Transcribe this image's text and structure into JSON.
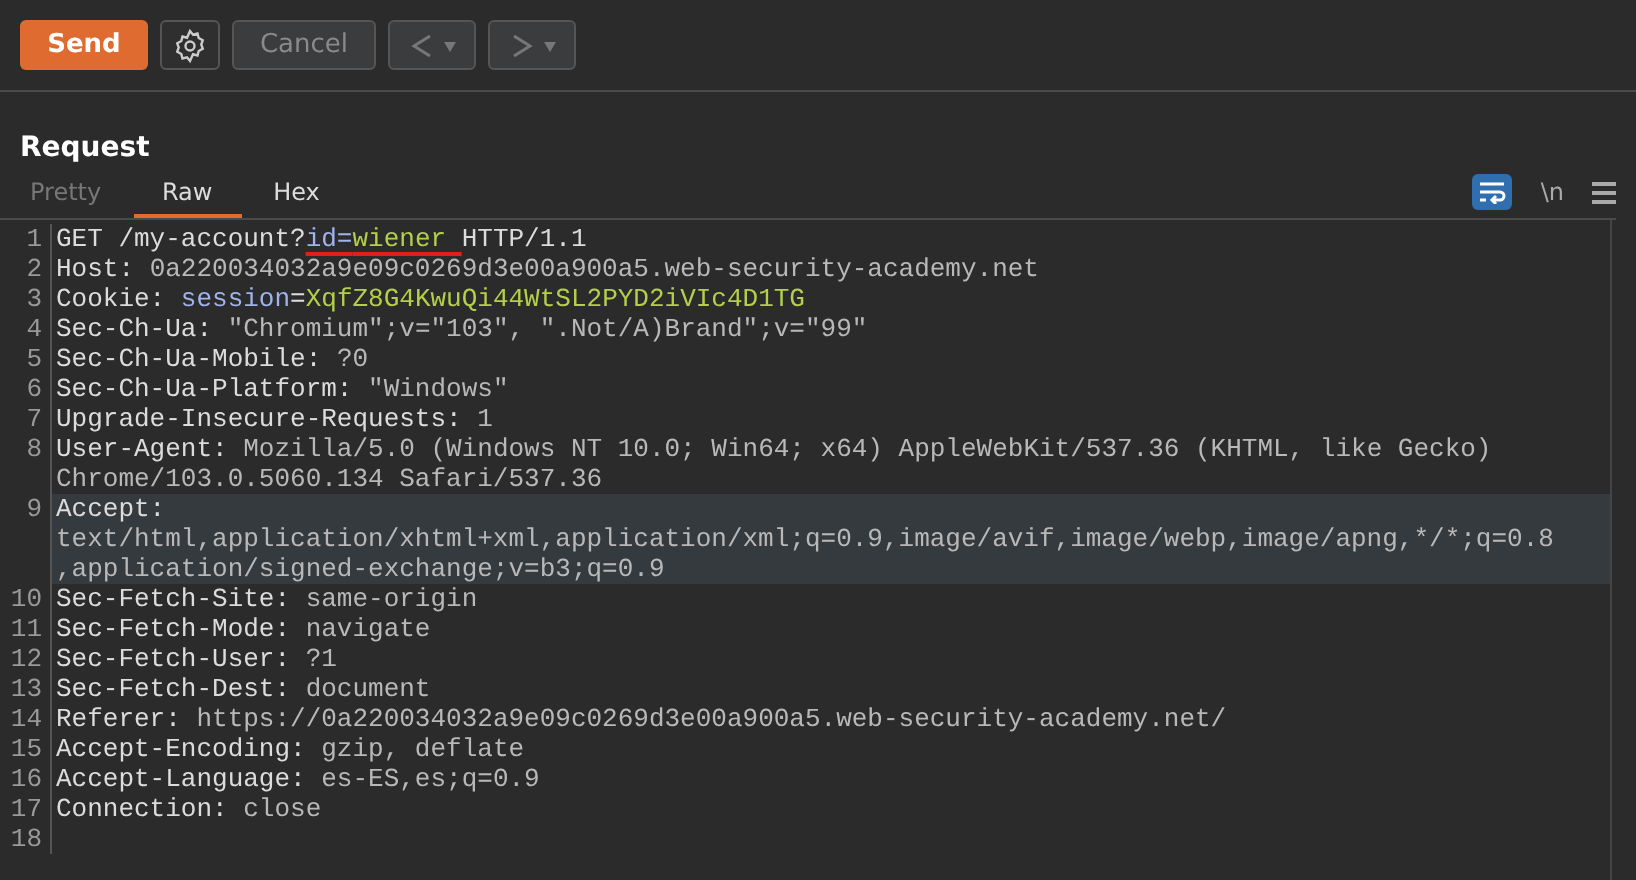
{
  "toolbar": {
    "send": "Send",
    "cancel": "Cancel",
    "back_disabled": true,
    "forward_disabled": true
  },
  "panel": {
    "title": "Request",
    "tabs": [
      {
        "label": "Pretty",
        "selected": false,
        "disabled": true
      },
      {
        "label": "Raw",
        "selected": true,
        "disabled": false
      },
      {
        "label": "Hex",
        "selected": false,
        "disabled": false
      }
    ],
    "wrap_on": true,
    "newline_label": "\\n"
  },
  "lines": [
    {
      "number": "1",
      "selected": false,
      "rows": [
        [
          {
            "text": "GET /my-account?",
            "kind": "name",
            "underlined": false
          },
          {
            "text": "id=",
            "kind": "param",
            "underlined": true
          },
          {
            "text": "wiener ",
            "kind": "param-value",
            "underlined": true
          },
          {
            "text": "HTTP/1.1",
            "kind": "name",
            "underlined": false
          }
        ]
      ]
    },
    {
      "number": "2",
      "selected": false,
      "rows": [
        [
          {
            "text": "Host: ",
            "kind": "name",
            "underlined": false
          },
          {
            "text": "0a220034032a9e09c0269d3e00a900a5.web-security-academy.net",
            "kind": "value",
            "underlined": false
          }
        ]
      ]
    },
    {
      "number": "3",
      "selected": false,
      "rows": [
        [
          {
            "text": "Cookie: ",
            "kind": "name",
            "underlined": false
          },
          {
            "text": "session",
            "kind": "param",
            "underlined": false
          },
          {
            "text": "=",
            "kind": "name",
            "underlined": false
          },
          {
            "text": "XqfZ8G4KwuQi44WtSL2PYD2iVIc4D1TG",
            "kind": "param-value",
            "underlined": false
          }
        ]
      ]
    },
    {
      "number": "4",
      "selected": false,
      "rows": [
        [
          {
            "text": "Sec-Ch-Ua: ",
            "kind": "name",
            "underlined": false
          },
          {
            "text": "\"Chromium\";v=\"103\", \".Not/A)Brand\";v=\"99\"",
            "kind": "value",
            "underlined": false
          }
        ]
      ]
    },
    {
      "number": "5",
      "selected": false,
      "rows": [
        [
          {
            "text": "Sec-Ch-Ua-Mobile: ",
            "kind": "name",
            "underlined": false
          },
          {
            "text": "?0",
            "kind": "value",
            "underlined": false
          }
        ]
      ]
    },
    {
      "number": "6",
      "selected": false,
      "rows": [
        [
          {
            "text": "Sec-Ch-Ua-Platform: ",
            "kind": "name",
            "underlined": false
          },
          {
            "text": "\"Windows\"",
            "kind": "value",
            "underlined": false
          }
        ]
      ]
    },
    {
      "number": "7",
      "selected": false,
      "rows": [
        [
          {
            "text": "Upgrade-Insecure-Requests: ",
            "kind": "name",
            "underlined": false
          },
          {
            "text": "1",
            "kind": "value",
            "underlined": false
          }
        ]
      ]
    },
    {
      "number": "8",
      "selected": false,
      "rows": [
        [
          {
            "text": "User-Agent: ",
            "kind": "name",
            "underlined": false
          },
          {
            "text": "Mozilla/5.0 (Windows NT 10.0; Win64; x64) AppleWebKit/537.36 (KHTML, like Gecko)",
            "kind": "value",
            "underlined": false
          }
        ],
        [
          {
            "text": "Chrome/103.0.5060.134 Safari/537.36",
            "kind": "value",
            "underlined": false
          }
        ]
      ]
    },
    {
      "number": "9",
      "selected": true,
      "rows": [
        [
          {
            "text": "Accept:",
            "kind": "name",
            "underlined": false
          }
        ],
        [
          {
            "text": "text/html,application/xhtml+xml,application/xml;q=0.9,image/avif,image/webp,image/apng,*/*;q=0.8",
            "kind": "value",
            "underlined": false
          }
        ],
        [
          {
            "text": ",application/signed-exchange;v=b3;q=0.9",
            "kind": "value",
            "underlined": false
          }
        ]
      ]
    },
    {
      "number": "10",
      "selected": false,
      "rows": [
        [
          {
            "text": "Sec-Fetch-Site: ",
            "kind": "name",
            "underlined": false
          },
          {
            "text": "same-origin",
            "kind": "value",
            "underlined": false
          }
        ]
      ]
    },
    {
      "number": "11",
      "selected": false,
      "rows": [
        [
          {
            "text": "Sec-Fetch-Mode: ",
            "kind": "name",
            "underlined": false
          },
          {
            "text": "navigate",
            "kind": "value",
            "underlined": false
          }
        ]
      ]
    },
    {
      "number": "12",
      "selected": false,
      "rows": [
        [
          {
            "text": "Sec-Fetch-User: ",
            "kind": "name",
            "underlined": false
          },
          {
            "text": "?1",
            "kind": "value",
            "underlined": false
          }
        ]
      ]
    },
    {
      "number": "13",
      "selected": false,
      "rows": [
        [
          {
            "text": "Sec-Fetch-Dest: ",
            "kind": "name",
            "underlined": false
          },
          {
            "text": "document",
            "kind": "value",
            "underlined": false
          }
        ]
      ]
    },
    {
      "number": "14",
      "selected": false,
      "rows": [
        [
          {
            "text": "Referer: ",
            "kind": "name",
            "underlined": false
          },
          {
            "text": "https://0a220034032a9e09c0269d3e00a900a5.web-security-academy.net/",
            "kind": "value",
            "underlined": false
          }
        ]
      ]
    },
    {
      "number": "15",
      "selected": false,
      "rows": [
        [
          {
            "text": "Accept-Encoding: ",
            "kind": "name",
            "underlined": false
          },
          {
            "text": "gzip, deflate",
            "kind": "value",
            "underlined": false
          }
        ]
      ]
    },
    {
      "number": "16",
      "selected": false,
      "rows": [
        [
          {
            "text": "Accept-Language: ",
            "kind": "name",
            "underlined": false
          },
          {
            "text": "es-ES,es;q=0.9",
            "kind": "value",
            "underlined": false
          }
        ]
      ]
    },
    {
      "number": "17",
      "selected": false,
      "rows": [
        [
          {
            "text": "Connection: ",
            "kind": "name",
            "underlined": false
          },
          {
            "text": "close",
            "kind": "value",
            "underlined": false
          }
        ]
      ]
    },
    {
      "number": "18",
      "selected": false,
      "rows": [
        []
      ]
    }
  ]
}
